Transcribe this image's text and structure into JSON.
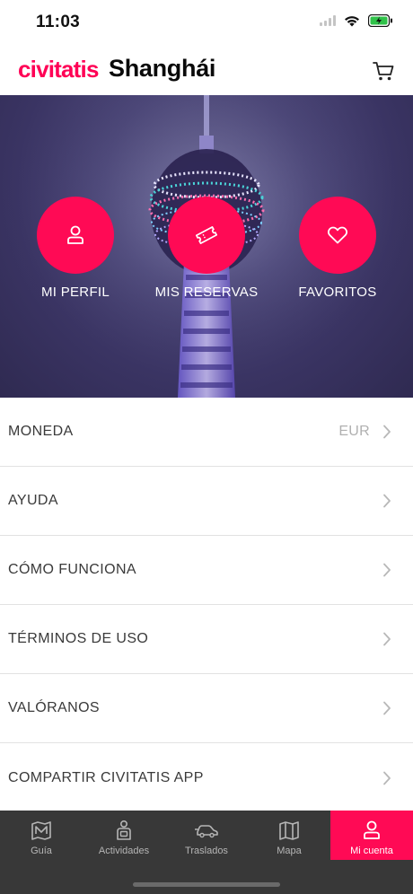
{
  "status": {
    "time": "11:03"
  },
  "header": {
    "brand": "civitatis",
    "city": "Shanghái"
  },
  "hero_actions": [
    {
      "label": "MI PERFIL",
      "icon": "user-icon"
    },
    {
      "label": "MIS RESERVAS",
      "icon": "ticket-icon"
    },
    {
      "label": "FAVORITOS",
      "icon": "heart-icon"
    }
  ],
  "settings": [
    {
      "label": "MONEDA",
      "value": "EUR"
    },
    {
      "label": "AYUDA"
    },
    {
      "label": "CÓMO FUNCIONA"
    },
    {
      "label": "TÉRMINOS DE USO"
    },
    {
      "label": "VALÓRANOS"
    },
    {
      "label": "COMPARTIR CIVITATIS APP"
    }
  ],
  "tabs": [
    {
      "label": "Guía",
      "icon": "map-guide-icon"
    },
    {
      "label": "Actividades",
      "icon": "activities-icon"
    },
    {
      "label": "Traslados",
      "icon": "transfer-car-icon"
    },
    {
      "label": "Mapa",
      "icon": "map-icon"
    },
    {
      "label": "Mi cuenta",
      "icon": "user-icon",
      "active": true
    }
  ],
  "colors": {
    "brand": "#ff0055",
    "tab_bar": "#383838",
    "hero_circle": "#ff0a55"
  }
}
